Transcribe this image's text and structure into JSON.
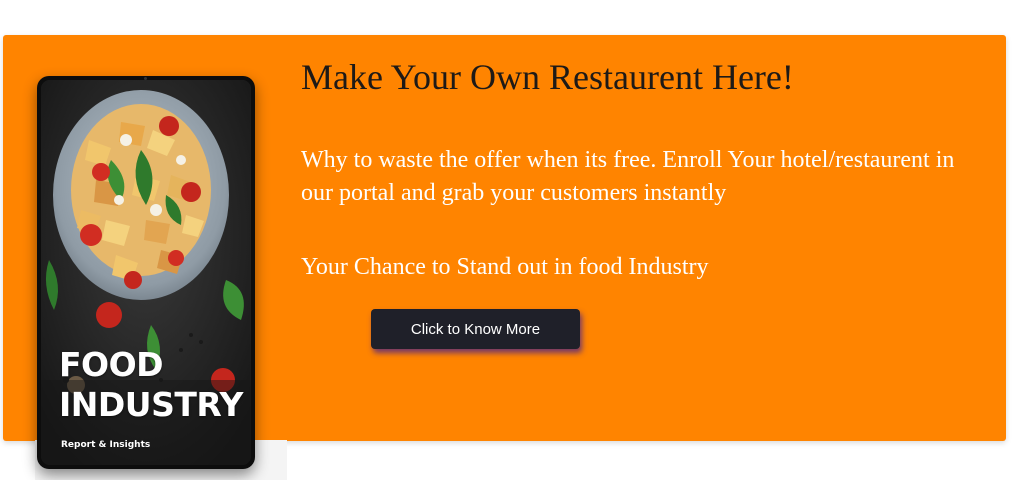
{
  "banner": {
    "background_color": "#ff8400",
    "headline": "Make Your Own Restaurent Here!",
    "description": "Why to waste the offer when its free. Enroll Your hotel/restaurent in our portal and grab your customers instantly",
    "tagline": "Your Chance to Stand out in food Industry",
    "cta_label": "Click to Know More"
  },
  "tablet": {
    "cover_title_line1": "FOOD",
    "cover_title_line2": "INDUSTRY",
    "cover_subtitle": "Report & Insights",
    "icon": "pasta-bowl-illustration"
  }
}
